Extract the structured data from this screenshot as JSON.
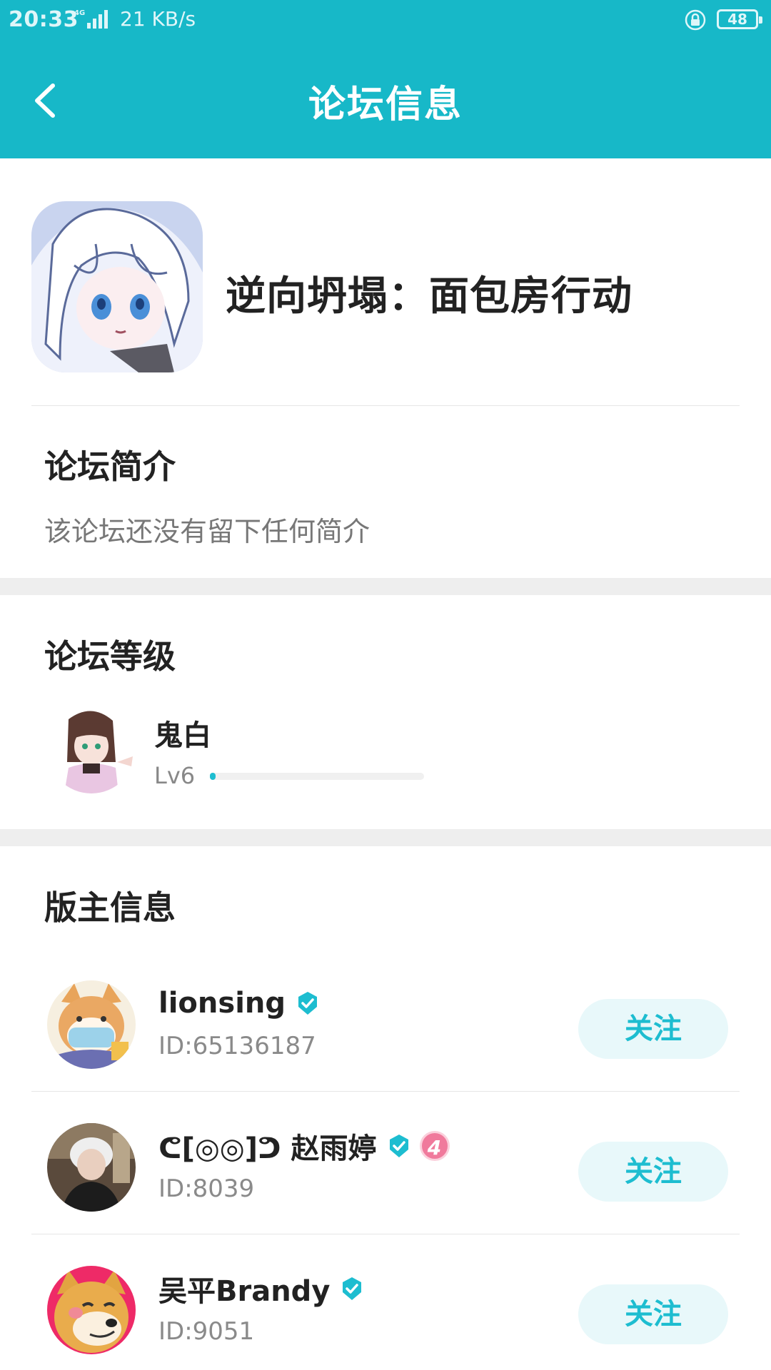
{
  "status_bar": {
    "time": "20:33",
    "network": "4G",
    "speed": "21 KB/s",
    "battery": "48"
  },
  "header": {
    "title": "论坛信息",
    "background_color": "#17b8c8"
  },
  "forum": {
    "name": "逆向坍塌：面包房行动",
    "avatar_icon": "forum-anime-avatar"
  },
  "intro": {
    "title": "论坛简介",
    "text": "该论坛还没有留下任何简介"
  },
  "level": {
    "title": "论坛等级",
    "name": "鬼白",
    "lv": "Lv6",
    "progress": 0.01
  },
  "moderators": {
    "title": "版主信息",
    "follow_label": "关注",
    "items": [
      {
        "name": "lionsing",
        "id": "ID:65136187",
        "verified": true,
        "badge": ""
      },
      {
        "name": "ᕦ[◎◎]ᕤ 赵雨婷",
        "id": "ID:8039",
        "verified": true,
        "badge": "4"
      },
      {
        "name": "吴平Brandy",
        "id": "ID:9051",
        "verified": true,
        "badge": ""
      }
    ]
  },
  "colors": {
    "accent": "#1dbdd0",
    "follow_bg": "#e8f8fa",
    "badge_pink": "#f07a9c"
  }
}
